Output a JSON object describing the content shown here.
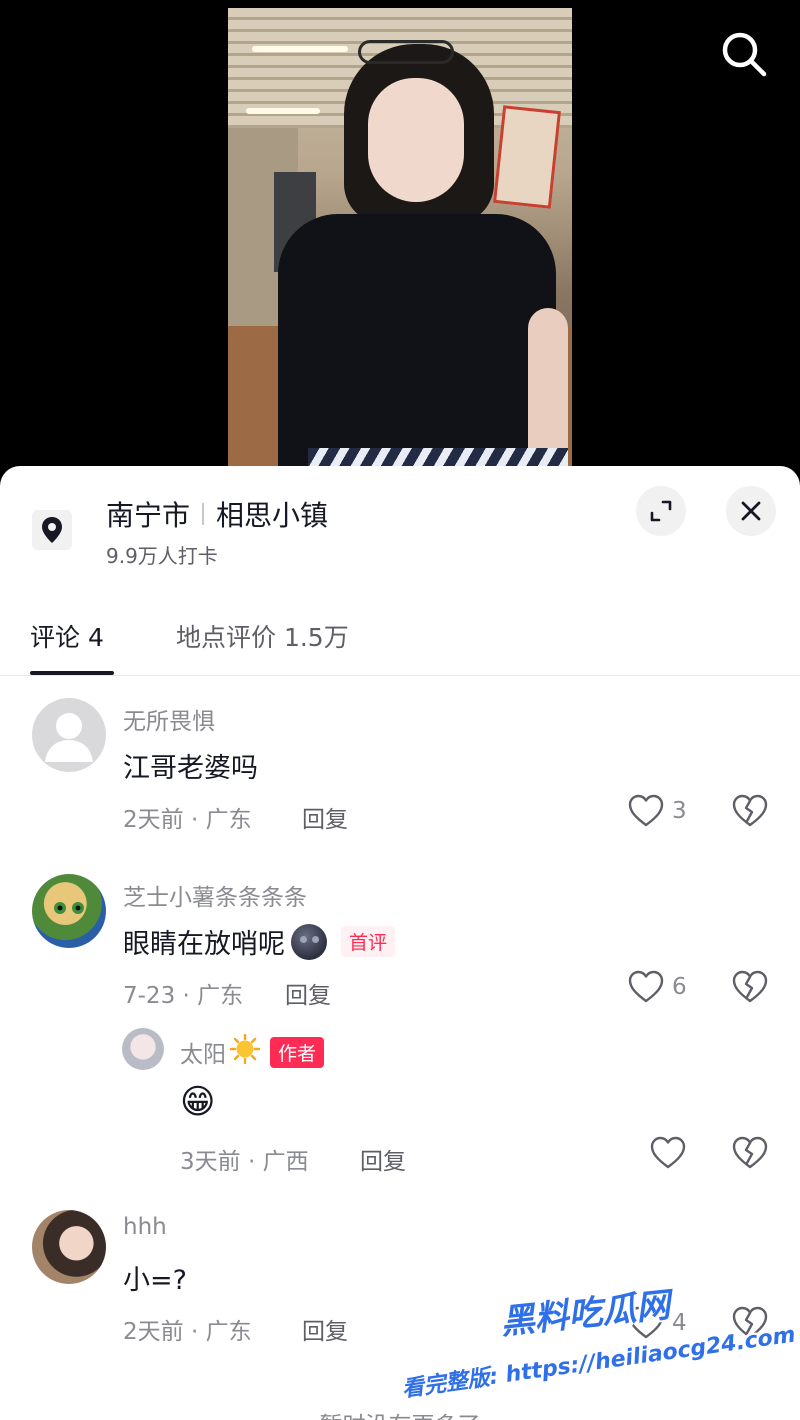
{
  "location": {
    "city": "南宁市",
    "place": "相思小镇",
    "checkins": "9.9万人打卡"
  },
  "tabs": {
    "comments": "评论 4",
    "reviews": "地点评价 1.5万"
  },
  "comments": [
    {
      "username": "无所畏惧",
      "text": "江哥老婆吗",
      "time_location": "2天前 · 广东",
      "reply_label": "回复",
      "likes": "3"
    },
    {
      "username": "芝士小薯条条条条",
      "text": "眼睛在放哨呢",
      "tag": "首评",
      "time_location": "7-23 · 广东",
      "reply_label": "回复",
      "likes": "6",
      "reply": {
        "username": "太阳",
        "tag": "作者",
        "text": "😁",
        "time_location": "3天前 · 广西",
        "reply_label": "回复",
        "likes": ""
      }
    },
    {
      "username": "hhh",
      "text": "小=?",
      "time_location": "2天前 · 广东",
      "reply_label": "回复",
      "likes": "4"
    }
  ],
  "footer": "暂时没有更多了",
  "watermark": {
    "brand": "黑料吃瓜网",
    "url_line": "看完整版: https://heiliaocg24.com"
  },
  "icons": {
    "search": "search-icon",
    "location": "location-pin-icon",
    "expand": "expand-icon",
    "close": "close-icon",
    "like": "heart-icon",
    "dislike": "broken-heart-icon"
  },
  "colors": {
    "accent": "#fe2c55",
    "text_primary": "#161823",
    "text_secondary": "#8a8b91"
  }
}
